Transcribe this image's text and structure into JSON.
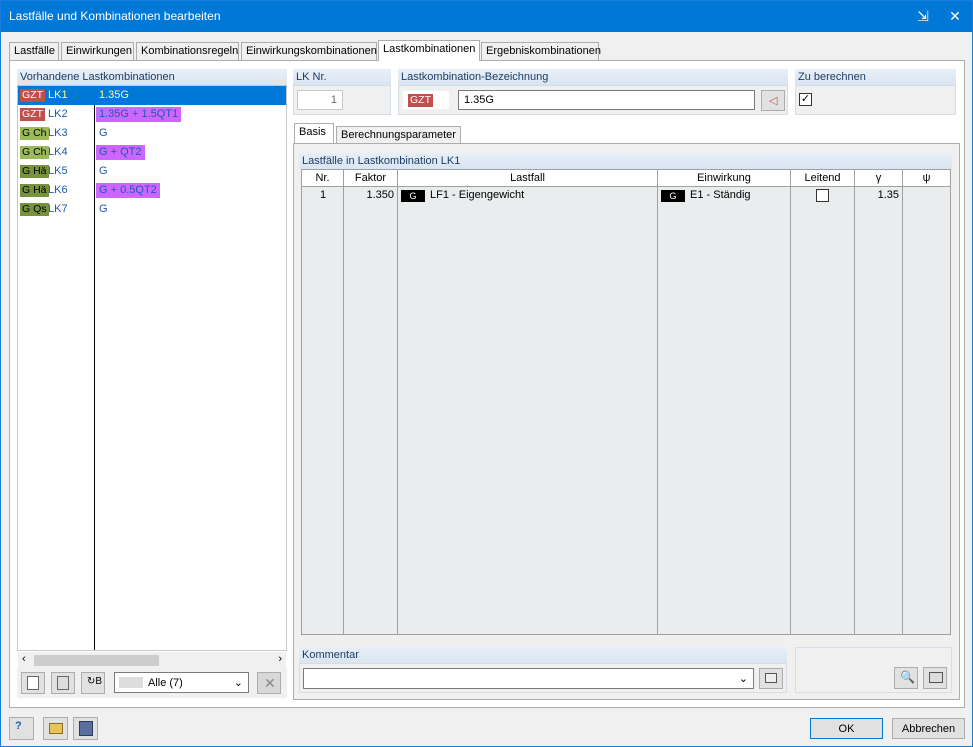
{
  "window": {
    "title": "Lastfälle und Kombinationen bearbeiten"
  },
  "tabs": [
    "Lastfälle",
    "Einwirkungen",
    "Kombinationsregeln",
    "Einwirkungskombinationen",
    "Lastkombinationen",
    "Ergebniskombinationen"
  ],
  "left_panel": {
    "header": "Vorhandene Lastkombinationen",
    "rows": [
      {
        "tag": "GZT",
        "tag_color": "#c0504d",
        "name": "LK1",
        "formula": "1.35G",
        "selected": true
      },
      {
        "tag": "GZT",
        "tag_color": "#c0504d",
        "name": "LK2",
        "formula": "1.35G + 1.5QT1",
        "formula_bg": "#cc66ff"
      },
      {
        "tag": "G Ch",
        "tag_color": "#9bbb59",
        "name": "LK3",
        "formula": "G"
      },
      {
        "tag": "G Ch",
        "tag_color": "#9bbb59",
        "name": "LK4",
        "formula": "G + QT2",
        "formula_bg": "#cc66ff"
      },
      {
        "tag": "G Hä",
        "tag_color": "#76923c",
        "name": "LK5",
        "formula": "G"
      },
      {
        "tag": "G Hä",
        "tag_color": "#76923c",
        "name": "LK6",
        "formula": "G + 0.5QT2",
        "formula_bg": "#cc66ff"
      },
      {
        "tag": "G Qs",
        "tag_color": "#76923c",
        "name": "LK7",
        "formula": "G"
      }
    ],
    "filter": "Alle (7)"
  },
  "lk_nr": {
    "label": "LK Nr.",
    "value": "1"
  },
  "bezeichnung": {
    "label": "Lastkombination-Bezeichnung",
    "tag": "GZT",
    "value": "1.35G"
  },
  "zu_berechnen": {
    "label": "Zu berechnen",
    "checked": true
  },
  "subtabs": [
    "Basis",
    "Berechnungsparameter"
  ],
  "table": {
    "title": "Lastfälle in Lastkombination LK1",
    "headers": [
      "Nr.",
      "Faktor",
      "Lastfall",
      "Einwirkung",
      "Leitend",
      "γ",
      "ψ"
    ],
    "rows": [
      {
        "nr": "1",
        "faktor": "1.350",
        "lastfall_tag": "G",
        "lastfall": "LF1 - Eigengewicht",
        "einwirkung_tag": "G",
        "einwirkung": "E1 - Ständig",
        "leitend": false,
        "gamma": "1.35",
        "psi": ""
      }
    ]
  },
  "kommentar": {
    "label": "Kommentar",
    "value": ""
  },
  "buttons": {
    "ok": "OK",
    "cancel": "Abbrechen"
  }
}
